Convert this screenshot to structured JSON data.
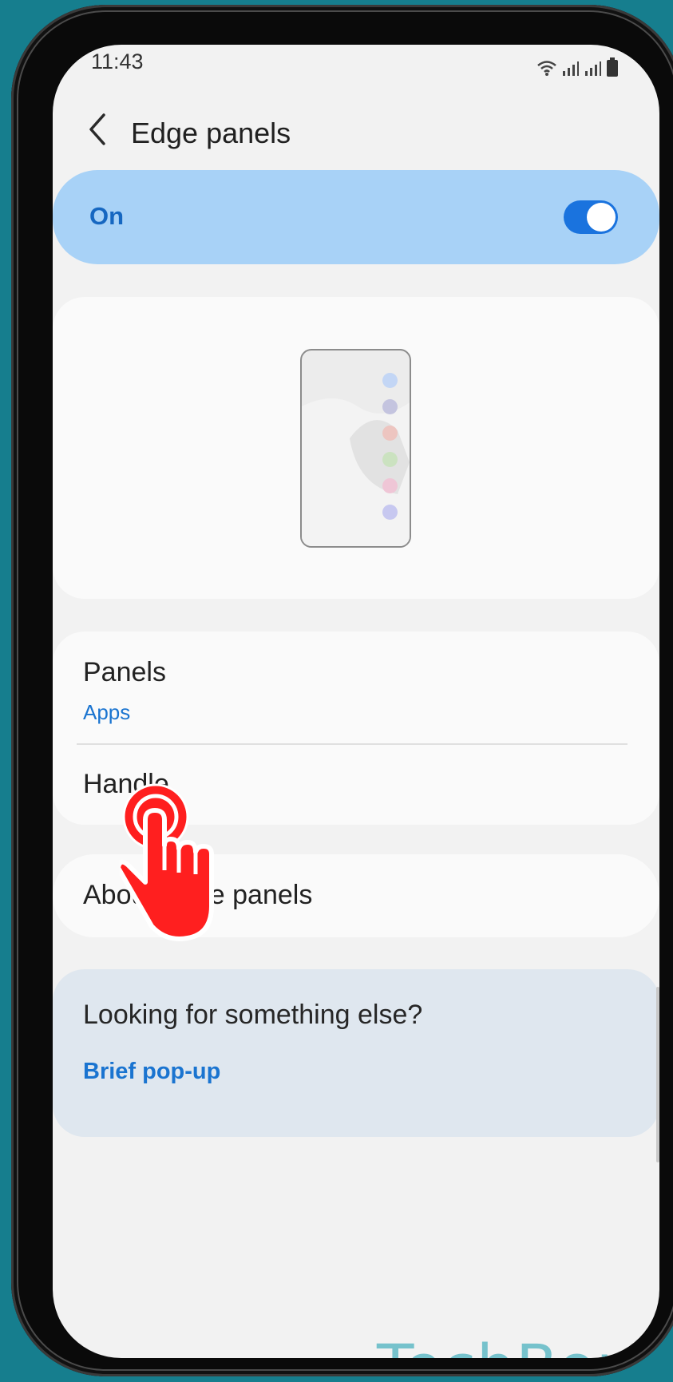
{
  "status_bar": {
    "time": "11:43"
  },
  "header": {
    "title": "Edge panels"
  },
  "master_toggle": {
    "label": "On",
    "state": "on"
  },
  "preview": {
    "dot_colors": [
      "#c3d6f5",
      "#c4c4df",
      "#edc5c0",
      "#cbe2c0",
      "#efc6d6",
      "#c7c8f0"
    ]
  },
  "settings": {
    "panels_title": "Panels",
    "panels_value": "Apps",
    "handle_title": "Handle",
    "about_title": "About Edge panels"
  },
  "suggestions": {
    "heading": "Looking for something else?",
    "link": "Brief pop-up"
  },
  "watermark": "TechBone",
  "colors": {
    "accent": "#1a73de",
    "toggle_card": "#a8d2f7",
    "tap_indicator": "#ff1f1f",
    "background": "#167e8e"
  }
}
